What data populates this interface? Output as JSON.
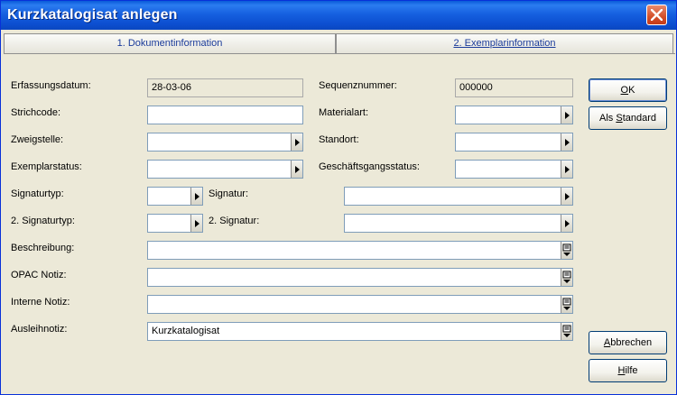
{
  "window": {
    "title": "Kurzkatalogisat anlegen"
  },
  "tabs": [
    {
      "label": "1. Dokumentinformation"
    },
    {
      "label": "2. Exemplarinformation"
    }
  ],
  "form": {
    "erfassungsdatum": {
      "label": "Erfassungsdatum:",
      "value": "28-03-06"
    },
    "sequenznummer": {
      "label": "Sequenznummer:",
      "value": "000000"
    },
    "strichcode": {
      "label": "Strichcode:",
      "value": ""
    },
    "materialart": {
      "label": "Materialart:",
      "value": ""
    },
    "zweigstelle": {
      "label": "Zweigstelle:",
      "value": ""
    },
    "standort": {
      "label": "Standort:",
      "value": ""
    },
    "exemplarstatus": {
      "label": "Exemplarstatus:",
      "value": ""
    },
    "geschaeftsgangsstatus": {
      "label": "Geschäftsgangsstatus:",
      "value": ""
    },
    "signaturtyp": {
      "label": "Signaturtyp:",
      "value": ""
    },
    "signatur": {
      "label": "Signatur:",
      "value": ""
    },
    "signaturtyp2": {
      "label": "2. Signaturtyp:",
      "value": ""
    },
    "signatur2": {
      "label": "2. Signatur:",
      "value": ""
    },
    "beschreibung": {
      "label": "Beschreibung:",
      "value": ""
    },
    "opac_notiz": {
      "label": "OPAC Notiz:",
      "value": ""
    },
    "interne_notiz": {
      "label": "Interne Notiz:",
      "value": ""
    },
    "ausleihnotiz": {
      "label": "Ausleihnotiz:",
      "value": "Kurzkatalogisat"
    }
  },
  "buttons": {
    "ok": {
      "pre": "",
      "key": "O",
      "post": "K"
    },
    "standard": {
      "pre": "Als ",
      "key": "S",
      "post": "tandard"
    },
    "abbrechen": {
      "pre": "",
      "key": "A",
      "post": "bbrechen"
    },
    "hilfe": {
      "pre": "",
      "key": "H",
      "post": "ilfe"
    }
  },
  "icons": {
    "close": "close-x-icon",
    "dropdown": "play-arrow-icon",
    "list": "list-picker-icon"
  }
}
